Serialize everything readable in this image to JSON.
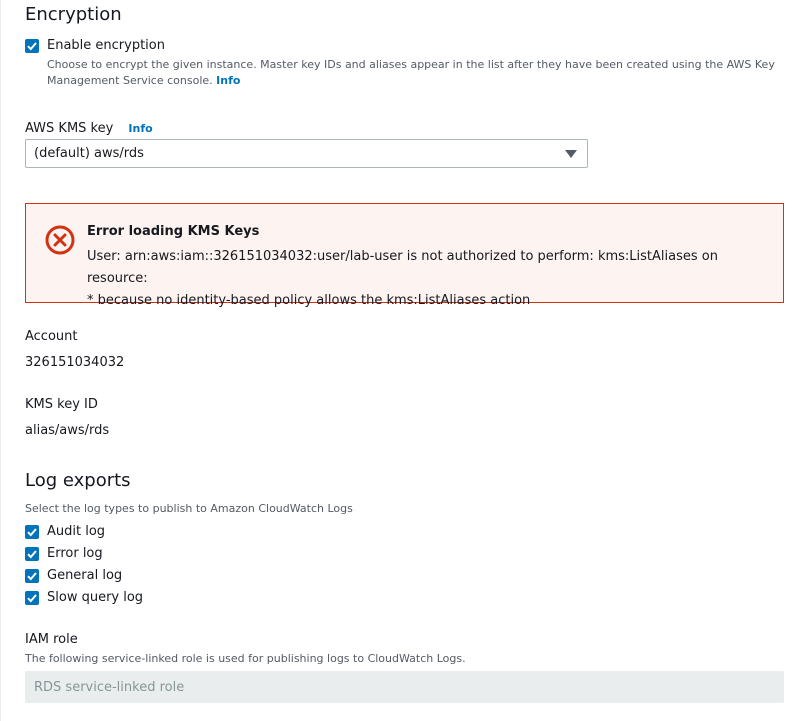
{
  "encryption": {
    "title": "Encryption",
    "enable_label": "Enable encryption",
    "enable_checked": true,
    "description": "Choose to encrypt the given instance. Master key IDs and aliases appear in the list after they have been created using the AWS Key Management Service console.",
    "description_info": "Info",
    "kms_key_label": "AWS KMS key",
    "kms_key_info": "Info",
    "kms_key_selected": "(default) aws/rds"
  },
  "error_alert": {
    "title": "Error loading KMS Keys",
    "line1": "User: arn:aws:iam::326151034032:user/lab-user is not authorized to perform: kms:ListAliases on resource:",
    "line2": "* because no identity-based policy allows the kms:ListAliases action",
    "color": "#d13212"
  },
  "account": {
    "label": "Account",
    "value": "326151034032"
  },
  "kms_key_id": {
    "label": "KMS key ID",
    "value": "alias/aws/rds"
  },
  "log_exports": {
    "title": "Log exports",
    "description": "Select the log types to publish to Amazon CloudWatch Logs",
    "options": [
      {
        "label": "Audit log",
        "checked": true
      },
      {
        "label": "Error log",
        "checked": true
      },
      {
        "label": "General log",
        "checked": true
      },
      {
        "label": "Slow query log",
        "checked": true
      }
    ]
  },
  "iam_role": {
    "label": "IAM role",
    "description": "The following service-linked role is used for publishing logs to CloudWatch Logs.",
    "placeholder": "RDS service-linked role"
  },
  "colors": {
    "accent": "#0073bb",
    "error": "#d13212",
    "error_bg": "#fdf3f1"
  }
}
